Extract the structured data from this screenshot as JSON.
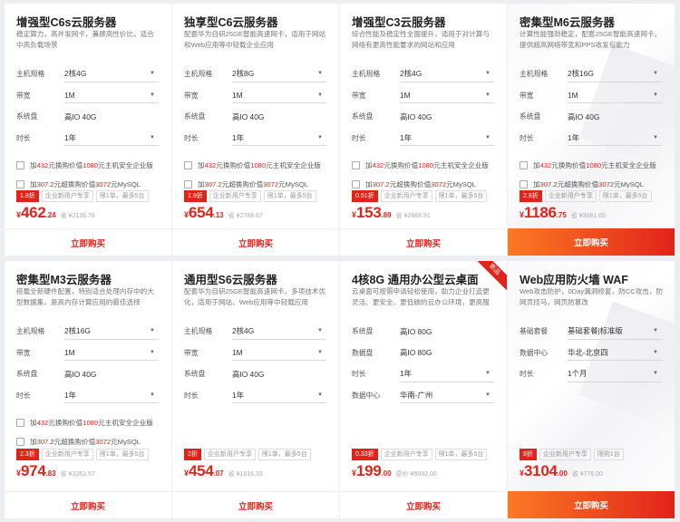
{
  "cards": [
    {
      "title": "增强型C6s云服务器",
      "desc": "稳定算力，高并发网卡，兼顾高性价比，适合中高负载场景",
      "fields": [
        {
          "label": "主机规格",
          "value": "2核4G",
          "select": true
        },
        {
          "label": "带宽",
          "value": "1M",
          "select": true
        },
        {
          "label": "系统盘",
          "value": "高IO 40G",
          "select": false
        },
        {
          "label": "时长",
          "value": "1年",
          "select": true
        }
      ],
      "checks": [
        {
          "pre": "加",
          "r1": "432",
          "mid": "元换购价值",
          "r2": "1080",
          "post": "元主机安全企业版"
        },
        {
          "pre": "加",
          "r1": "307.2",
          "mid": "元超换购价值",
          "r2": "3072",
          "post": "元MySQL"
        }
      ],
      "tags": [
        {
          "text": "1.8折",
          "hot": true
        },
        {
          "text": "企业新用户专享",
          "hot": false
        },
        {
          "text": "限1单，最多5台",
          "hot": false
        }
      ],
      "price": {
        "symbol": "¥",
        "int": "462",
        "dec": ".24",
        "orig": "省 ¥2135.76"
      },
      "buy": "立即购买"
    },
    {
      "title": "独享型C6云服务器",
      "desc": "配套华为自研25GE智能高速网卡，适用于网站和Web应用等中轻载企业应用",
      "fields": [
        {
          "label": "主机规格",
          "value": "2核8G",
          "select": true
        },
        {
          "label": "带宽",
          "value": "1M",
          "select": true
        },
        {
          "label": "系统盘",
          "value": "高IO 40G",
          "select": false
        },
        {
          "label": "时长",
          "value": "1年",
          "select": true
        }
      ],
      "checks": [
        {
          "pre": "加",
          "r1": "432",
          "mid": "元换购价值",
          "r2": "1080",
          "post": "元主机安全企业版"
        },
        {
          "pre": "加",
          "r1": "307.2",
          "mid": "元超换购价值",
          "r2": "3072",
          "post": "元MySQL"
        }
      ],
      "tags": [
        {
          "text": "1.9折",
          "hot": true
        },
        {
          "text": "企业新用户专享",
          "hot": false
        },
        {
          "text": "限1单，最多5台",
          "hot": false
        }
      ],
      "price": {
        "symbol": "¥",
        "int": "654",
        "dec": ".13",
        "orig": "省 ¥2788.67"
      },
      "buy": "立即购买"
    },
    {
      "title": "增强型C3云服务器",
      "desc": "综合性能及稳定性全面提升，适用于对计算与网络有更高性能要求的网站和应用",
      "fields": [
        {
          "label": "主机规格",
          "value": "2核4G",
          "select": true
        },
        {
          "label": "带宽",
          "value": "1M",
          "select": true
        },
        {
          "label": "系统盘",
          "value": "高IO 40G",
          "select": false
        },
        {
          "label": "时长",
          "value": "1年",
          "select": true
        }
      ],
      "checks": [
        {
          "pre": "加",
          "r1": "432",
          "mid": "元换购价值",
          "r2": "1080",
          "post": "元主机安全企业版"
        },
        {
          "pre": "加",
          "r1": "307.2",
          "mid": "元超换购价值",
          "r2": "3072",
          "post": "元MySQL"
        }
      ],
      "tags": [
        {
          "text": "0.51折",
          "hot": true
        },
        {
          "text": "企业新用户专享",
          "hot": false
        },
        {
          "text": "限1单，最多5台",
          "hot": false
        }
      ],
      "price": {
        "symbol": "¥",
        "int": "153",
        "dec": ".89",
        "orig": "省 ¥2868.91"
      },
      "buy": "立即购买"
    },
    {
      "title": "密集型M6云服务器",
      "desc": "计算性能强劲稳定，配套25GE智能高速网卡，提供超高网络带宽和PPS收发包能力",
      "highlight": true,
      "fields": [
        {
          "label": "主机规格",
          "value": "2核16G",
          "select": true
        },
        {
          "label": "带宽",
          "value": "1M",
          "select": true
        },
        {
          "label": "系统盘",
          "value": "高IO 40G",
          "select": false
        },
        {
          "label": "时长",
          "value": "1年",
          "select": true
        }
      ],
      "checks": [
        {
          "pre": "加",
          "r1": "432",
          "mid": "元换购价值",
          "r2": "1080",
          "post": "元主机安全企业版"
        },
        {
          "pre": "加",
          "r1": "307.2",
          "mid": "元超换购价值",
          "r2": "3072",
          "post": "元MySQL"
        }
      ],
      "tags": [
        {
          "text": "2.8折",
          "hot": true
        },
        {
          "text": "企业新用户专享",
          "hot": false
        },
        {
          "text": "限1单，最多5台",
          "hot": false
        }
      ],
      "price": {
        "symbol": "¥",
        "int": "1186",
        "dec": ".75",
        "orig": "省 ¥3061.65"
      },
      "buy": "立即购买",
      "orange": true
    },
    {
      "title": "密集型M3云服务器",
      "desc": "搭载全新硬件配置，特别适合处理内存中的大型数据集，是高内存计算应用的最佳选择",
      "fields": [
        {
          "label": "主机规格",
          "value": "2核16G",
          "select": true
        },
        {
          "label": "带宽",
          "value": "1M",
          "select": true
        },
        {
          "label": "系统盘",
          "value": "高IO 40G",
          "select": false
        },
        {
          "label": "时长",
          "value": "1年",
          "select": true
        }
      ],
      "checks": [
        {
          "pre": "加",
          "r1": "432",
          "mid": "元换购价值",
          "r2": "1080",
          "post": "元主机安全企业版"
        },
        {
          "pre": "加",
          "r1": "307.2",
          "mid": "元超换购价值",
          "r2": "3072",
          "post": "元MySQL"
        }
      ],
      "tags": [
        {
          "text": "2.3折",
          "hot": true
        },
        {
          "text": "企业新用户专享",
          "hot": false
        },
        {
          "text": "限1单，最多5台",
          "hot": false
        }
      ],
      "price": {
        "symbol": "¥",
        "int": "974",
        "dec": ".83",
        "orig": "省 ¥3263.57"
      },
      "buy": "立即购买"
    },
    {
      "title": "通用型S6云服务器",
      "desc": "配套华为自研25GE智能高速网卡，多项技术优化，适用于网站、Web应用等中轻载应用",
      "fields": [
        {
          "label": "主机规格",
          "value": "2核4G",
          "select": true
        },
        {
          "label": "带宽",
          "value": "1M",
          "select": true
        },
        {
          "label": "系统盘",
          "value": "高IO 40G",
          "select": false
        },
        {
          "label": "时长",
          "value": "1年",
          "select": true
        }
      ],
      "checks": [],
      "tags": [
        {
          "text": "2折",
          "hot": true
        },
        {
          "text": "企业新用户专享",
          "hot": false
        },
        {
          "text": "限1单，最多5台",
          "hot": false
        }
      ],
      "price": {
        "symbol": "¥",
        "int": "454",
        "dec": ".07",
        "orig": "省 ¥1816.33"
      },
      "buy": "立即购买"
    },
    {
      "title": "4核8G 通用办公型云桌面",
      "desc": "云桌面可按需申请轻松使用，助力企业打造更灵活、更安全、更低碳的云办公环境，更高服务效率的办",
      "badge": "新品",
      "fields": [
        {
          "label": "系统盘",
          "value": "高IO 80G",
          "select": false
        },
        {
          "label": "数据盘",
          "value": "高IO 80G",
          "select": false
        },
        {
          "label": "时长",
          "value": "1年",
          "select": true
        },
        {
          "label": "数据中心",
          "value": "华南-广州",
          "select": true
        }
      ],
      "checks": [],
      "tags": [
        {
          "text": "0.33折",
          "hot": true
        },
        {
          "text": "企业新用户专享",
          "hot": false
        },
        {
          "text": "限1单，最多5台",
          "hot": false
        }
      ],
      "price": {
        "symbol": "¥",
        "int": "199",
        "dec": ".00",
        "orig": "原价 ¥6092.00"
      },
      "buy": "立即购买"
    },
    {
      "title": "Web应用防火墙 WAF",
      "desc": "Web攻击防护，0Day漏洞修复，防CC攻击，防网页挂马，网页防篡改",
      "highlight": true,
      "fields": [
        {
          "label": "基础套餐",
          "value": "基础套餐|标准版",
          "select": true
        },
        {
          "label": "数据中心",
          "value": "华北-北京四",
          "select": true
        },
        {
          "label": "时长",
          "value": "1个月",
          "select": true
        }
      ],
      "checks": [],
      "tags": [
        {
          "text": "8折",
          "hot": true
        },
        {
          "text": "企业新用户专享",
          "hot": false
        },
        {
          "text": "限购1台",
          "hot": false
        }
      ],
      "price": {
        "symbol": "¥",
        "int": "3104",
        "dec": ".00",
        "orig": "省 ¥776.00"
      },
      "buy": "立即购买",
      "orange": true
    }
  ]
}
